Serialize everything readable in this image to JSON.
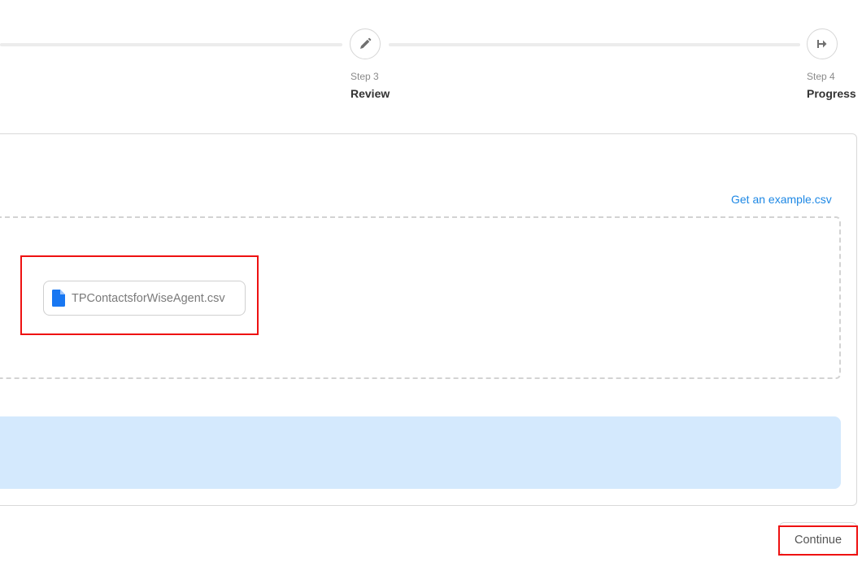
{
  "stepper": {
    "steps": [
      {
        "caption": "Step 3",
        "title": "Review",
        "icon": "pencil-icon"
      },
      {
        "caption": "Step 4",
        "title": "Progress",
        "icon": "arrow-right-to-line-icon"
      }
    ]
  },
  "upload": {
    "example_link": "Get an example.csv",
    "file_name": "TPContactsforWiseAgent.csv",
    "file_icon": "file-icon"
  },
  "actions": {
    "continue_label": "Continue"
  },
  "colors": {
    "accent": "#1e88e5",
    "banner": "#d4e9fd",
    "highlight": "#ee1111"
  }
}
